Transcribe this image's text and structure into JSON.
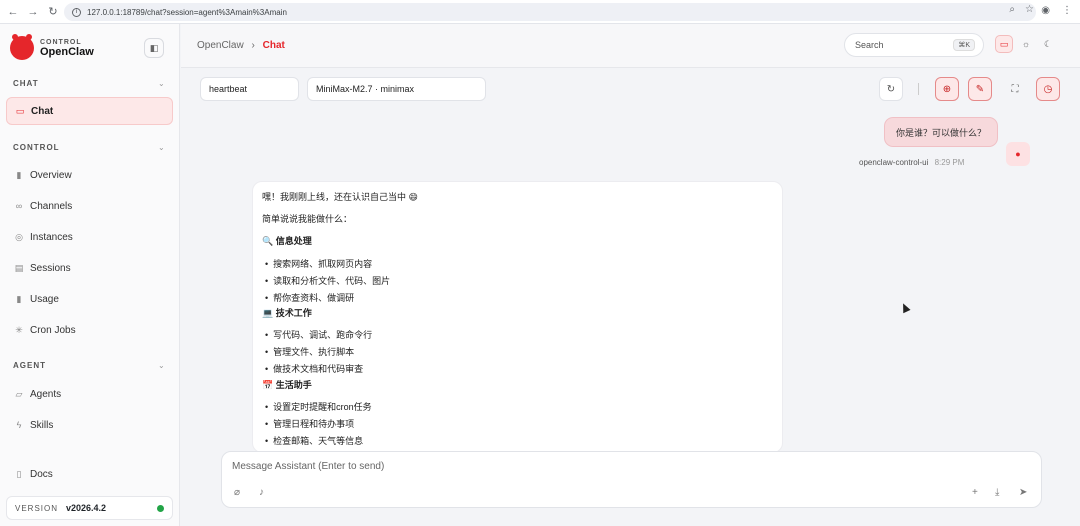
{
  "browser": {
    "url": "127.0.0.1:18789/chat?session=agent%3Amain%3Amain"
  },
  "brand": {
    "sub": "CONTROL",
    "name": "OpenClaw"
  },
  "sidebar": {
    "sections": {
      "chat": "CHAT",
      "control": "CONTROL",
      "agent": "AGENT"
    },
    "items": [
      {
        "label": "Chat",
        "icon": "message-icon"
      },
      {
        "label": "Overview",
        "icon": "bar-chart-icon"
      },
      {
        "label": "Channels",
        "icon": "link-icon"
      },
      {
        "label": "Instances",
        "icon": "radio-icon"
      },
      {
        "label": "Sessions",
        "icon": "document-icon"
      },
      {
        "label": "Usage",
        "icon": "bar-chart-icon"
      },
      {
        "label": "Cron Jobs",
        "icon": "loader-icon"
      },
      {
        "label": "Agents",
        "icon": "folder-icon"
      },
      {
        "label": "Skills",
        "icon": "zap-icon"
      },
      {
        "label": "Docs",
        "icon": "book-icon"
      }
    ],
    "version_label": "VERSION",
    "version": "v2026.4.2"
  },
  "header": {
    "breadcrumb_root": "OpenClaw",
    "breadcrumb_sep": "›",
    "breadcrumb_current": "Chat",
    "search_placeholder": "Search",
    "search_shortcut": "⌘K"
  },
  "toolbar": {
    "session": "heartbeat",
    "model": "MiniMax-M2.7 · minimax"
  },
  "messages": {
    "user_text": "你是谁？可以做什么？",
    "user_name": "openclaw-control-ui",
    "user_time": "8:29 PM",
    "assistant_lines": [
      {
        "t": "嘿！我刚刚上线，还在认识自己当中 😄",
        "k": "p"
      },
      {
        "t": "简单说说我能做什么：",
        "k": "p"
      },
      {
        "t": "🔍 信息处理",
        "k": "h"
      },
      {
        "t": "搜索网络、抓取网页内容",
        "k": "li"
      },
      {
        "t": "读取和分析文件、代码、图片",
        "k": "li"
      },
      {
        "t": "帮你查资料、做调研",
        "k": "li"
      },
      {
        "t": "💻 技术工作",
        "k": "h"
      },
      {
        "t": "写代码、调试、跑命令行",
        "k": "li"
      },
      {
        "t": "管理文件、执行脚本",
        "k": "li"
      },
      {
        "t": "做技术文档和代码审查",
        "k": "li"
      },
      {
        "t": "📅 生活助手",
        "k": "h"
      },
      {
        "t": "设置定时提醒和cron任务",
        "k": "li"
      },
      {
        "t": "管理日程和待办事项",
        "k": "li"
      },
      {
        "t": "检查邮箱、天气等信息",
        "k": "li"
      }
    ]
  },
  "composer": {
    "placeholder": "Message Assistant (Enter to send)"
  }
}
